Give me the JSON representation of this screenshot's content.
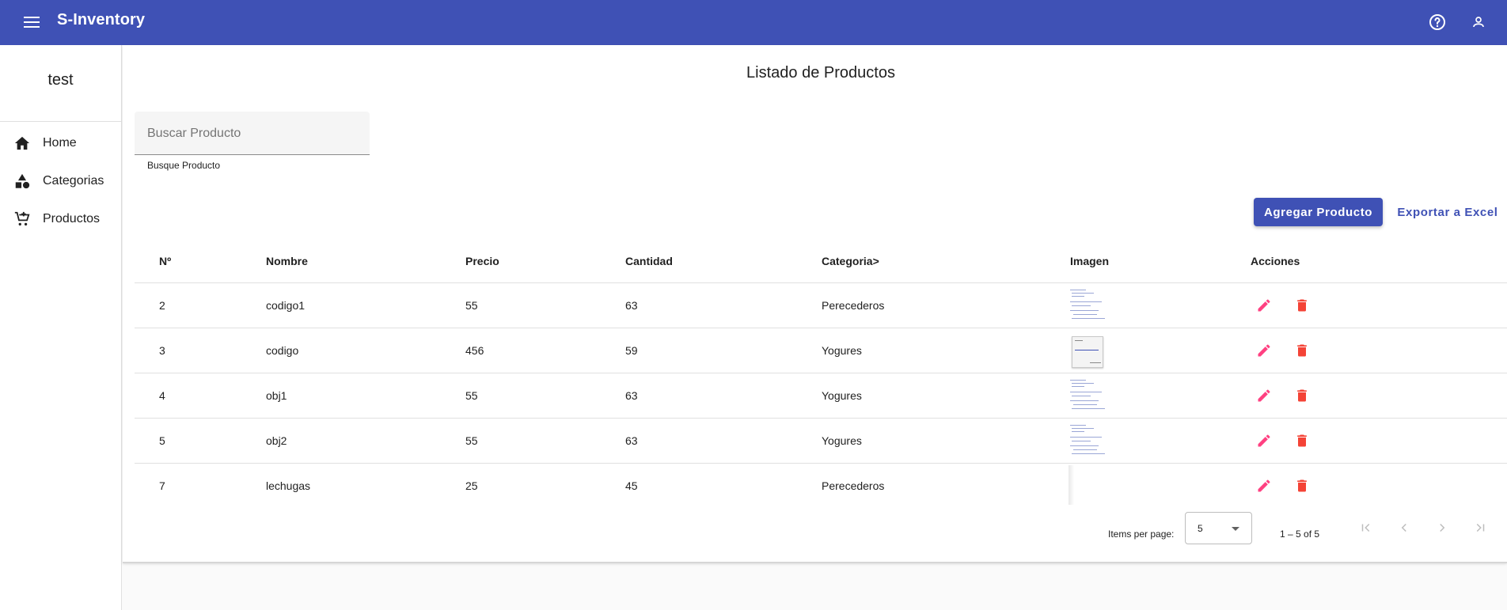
{
  "app": {
    "title": "S-Inventory"
  },
  "sidebar": {
    "user_name": "test",
    "items": [
      {
        "label": "Home",
        "icon": "home-icon"
      },
      {
        "label": "Categorias",
        "icon": "category-icon"
      },
      {
        "label": "Productos",
        "icon": "shopping-cart-icon"
      }
    ]
  },
  "main": {
    "title": "Listado de Productos",
    "search": {
      "placeholder": "Buscar Producto",
      "value": "",
      "hint": "Busque Producto"
    },
    "add_label": "Agregar Producto",
    "export_label": "Exportar a Excel"
  },
  "table": {
    "headers": [
      "Nº",
      "Nombre",
      "Precio",
      "Cantidad",
      "Categoria>",
      "Imagen",
      "Acciones"
    ],
    "rows": [
      {
        "id": "2",
        "name": "codigo1",
        "price": "55",
        "qty": "63",
        "category": "Perecederos",
        "image": "code-screenshot-thumbnail"
      },
      {
        "id": "3",
        "name": "codigo",
        "price": "456",
        "qty": "59",
        "category": "Yogures",
        "image": "dialog-screenshot-thumbnail"
      },
      {
        "id": "4",
        "name": "obj1",
        "price": "55",
        "qty": "63",
        "category": "Yogures",
        "image": "code-screenshot-thumbnail"
      },
      {
        "id": "5",
        "name": "obj2",
        "price": "55",
        "qty": "63",
        "category": "Yogures",
        "image": "code-screenshot-thumbnail"
      },
      {
        "id": "7",
        "name": "lechugas",
        "price": "25",
        "qty": "45",
        "category": "Perecederos",
        "image": "blank-thumbnail"
      }
    ]
  },
  "paginator": {
    "items_label": "Items per page:",
    "page_size": "5",
    "range": "1 – 5 of 5"
  },
  "colors": {
    "primary": "#3f51b5",
    "accent_edit": "#ff4081",
    "delete": "#f44336"
  }
}
